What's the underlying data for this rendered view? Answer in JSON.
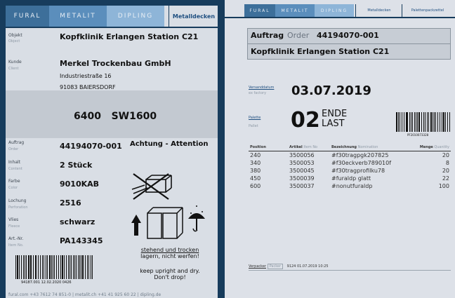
{
  "left_label": {
    "brands": [
      "FURAL",
      "METALIT",
      "DIPLING"
    ],
    "tab": "Metalldecken",
    "fields": {
      "object": {
        "label": "Objekt",
        "sublabel": "Object",
        "value": "Kopfklinik Erlangen Station C21"
      },
      "client": {
        "label": "Kunde",
        "sublabel": "Client",
        "value": "Merkel Trockenbau GmbH",
        "street": "Industriestraße 16",
        "city": "91083 BAIERSDORF"
      },
      "product": "6400   SW1600",
      "order": {
        "label": "Auftrag",
        "sublabel": "Order",
        "value": "44194070-001"
      },
      "content": {
        "label": "Inhalt",
        "sublabel": "Content",
        "value": "2 Stück"
      },
      "color": {
        "label": "Farbe",
        "sublabel": "Color",
        "value": "9010KAB"
      },
      "perforation": {
        "label": "Lochung",
        "sublabel": "Perforation",
        "value": "2516"
      },
      "fleece": {
        "label": "Vlies",
        "sublabel": "Fleece",
        "value": "schwarz"
      },
      "item_no": {
        "label": "Art.-Nr.",
        "sublabel": "Item No.",
        "value": "PA143345"
      }
    },
    "warning": {
      "title": "Achtung - Attention",
      "de_line1": "stehend und trocken",
      "de_line2": "lagern, nicht werfen!",
      "en_line1": "keep upright and dry.",
      "en_line2": "Don't drop!"
    },
    "barcode_text": "94187.001  12.02.2020  0426",
    "footer": "fural.com +43 7612 74 851-0 | metalit.ch +41 41 925 60 22 | dipling.de"
  },
  "right_label": {
    "brands": [
      "FURAL",
      "METALIT",
      "DIPLING"
    ],
    "tabs": [
      "Metalldecken",
      "Palettenpackzettel"
    ],
    "order_label": "Auftrag",
    "order_sublabel": "Order",
    "order_value": "44194070-001",
    "project": "Kopfklinik Erlangen Station C21",
    "ship_date_label": "Versanddatum",
    "ship_date_sublabel": "ex factory",
    "ship_date": "03.07.2019",
    "pallet_label": "Palette",
    "pallet_sublabel": "Pallet",
    "pallet_no": "02",
    "pallet_status_1": "ENDE",
    "pallet_status_2": "LAST",
    "barcode_text": "PF2010073328",
    "table": {
      "headers": {
        "pos": "Position",
        "art": "Artikel",
        "art_sub": "Item No",
        "desc": "Bezeichnung",
        "desc_sub": "Nomination",
        "qty": "Menge",
        "qty_sub": "Quantity"
      },
      "rows": [
        {
          "pos": "240",
          "art": "3500056",
          "desc": "#f30tragpgk207825",
          "qty": "20"
        },
        {
          "pos": "340",
          "art": "3500053",
          "desc": "#f30eckverb789010f",
          "qty": "8"
        },
        {
          "pos": "380",
          "art": "3500045",
          "desc": "#f30tragprofilku78",
          "qty": "20"
        },
        {
          "pos": "450",
          "art": "3500039",
          "desc": "#furaldp glatt",
          "qty": "22"
        },
        {
          "pos": "600",
          "art": "3500037",
          "desc": "#nonutfuraldp",
          "qty": "100"
        }
      ]
    },
    "packer_label": "Verpacker",
    "packer_sublabel": "Packer",
    "packer_value": "9124  01.07.2019 10:25"
  },
  "colors": {
    "background": "#173c5c",
    "label": "#d9dee5",
    "brand_dark": "#3d6f9a",
    "brand_mid": "#5b8ebc",
    "brand_light": "#8eb5d8"
  }
}
